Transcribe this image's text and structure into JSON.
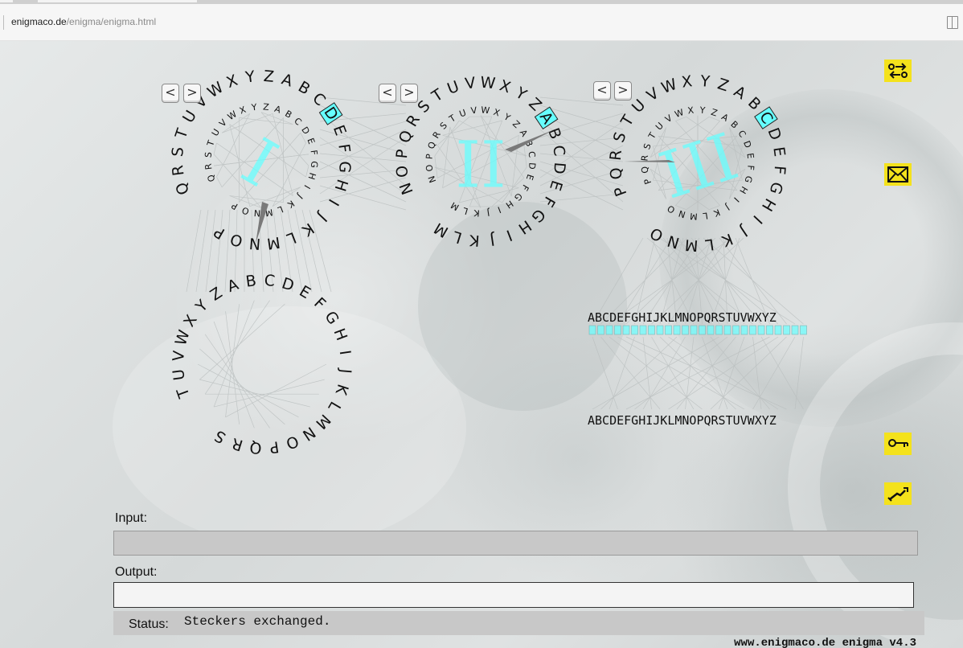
{
  "browser": {
    "url_domain": "enigmaco.de",
    "url_path": "/enigma/enigma.html"
  },
  "alphabet": "ABCDEFGHIJKLMNOPQRSTUVWXYZ",
  "rotors": [
    {
      "numeral": "I",
      "position": "D"
    },
    {
      "numeral": "II",
      "position": "A"
    },
    {
      "numeral": "III",
      "position": "C"
    }
  ],
  "rotor_buttons": {
    "prev": "<",
    "next": ">"
  },
  "plugboard": {
    "top_row": "ABCDEFGHIJKLMNOPQRSTUVWXYZ",
    "bottom_row": "ABCDEFGHIJKLMNOPQRSTUVWXYZ"
  },
  "side_buttons": [
    {
      "icon": "swap-arrows-icon"
    },
    {
      "icon": "envelope-icon"
    },
    {
      "icon": "key-icon"
    },
    {
      "icon": "wrench-icon"
    }
  ],
  "input": {
    "label": "Input:",
    "value": ""
  },
  "output": {
    "label": "Output:",
    "value": ""
  },
  "status": {
    "label": "Status:",
    "message": "Steckers exchanged."
  },
  "footer": "www.enigmaco.de enigma v4.3",
  "colors": {
    "accent": "#66ffff",
    "button_yellow": "#f4e21c"
  }
}
